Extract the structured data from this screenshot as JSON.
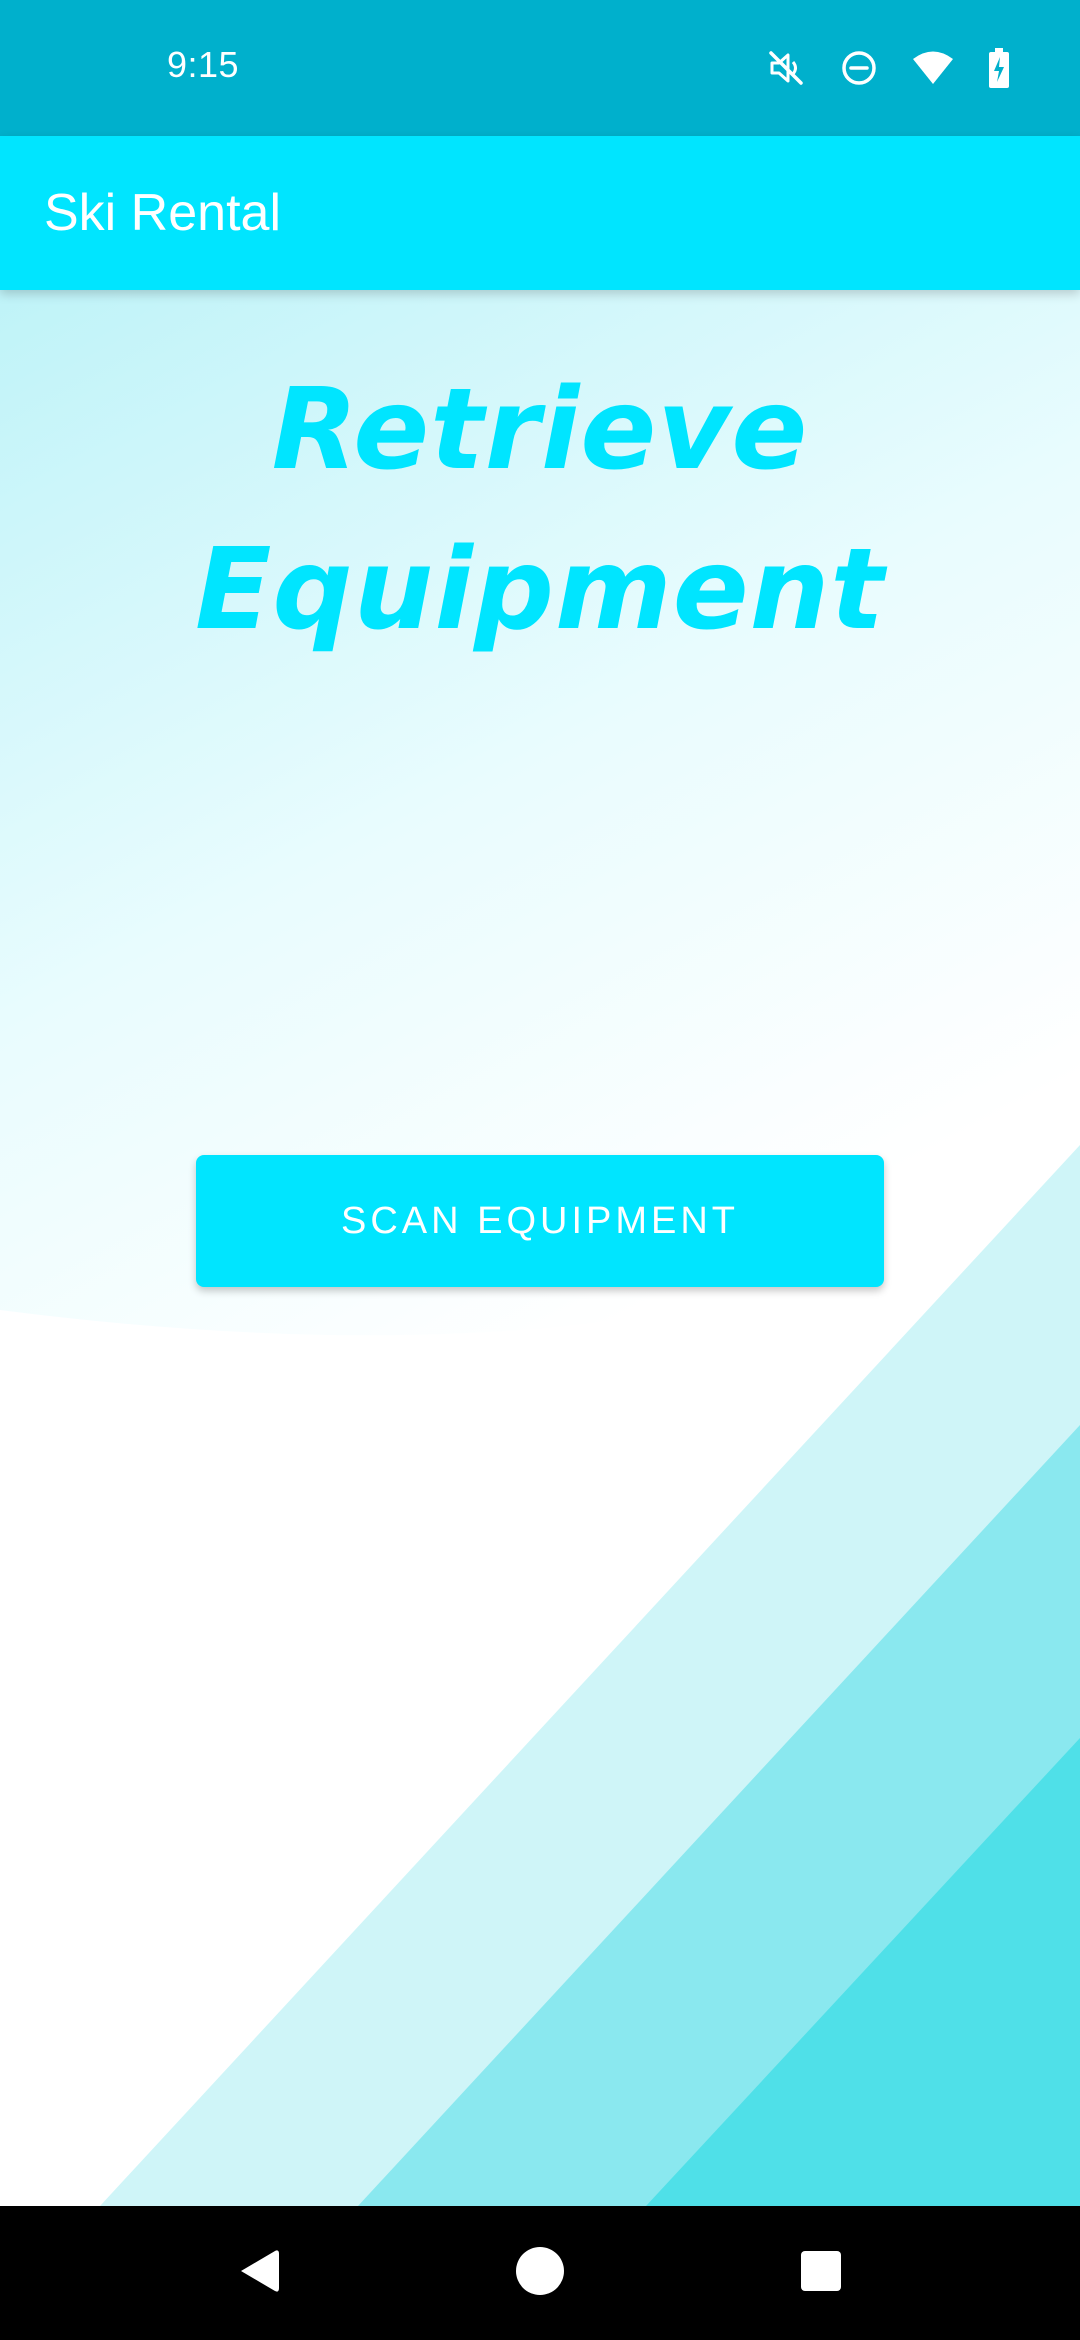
{
  "status_bar": {
    "time": "9:15",
    "icons": [
      "mute-icon",
      "do-not-disturb-icon",
      "wifi-icon",
      "battery-charging-icon"
    ]
  },
  "app_bar": {
    "title": "Ski Rental"
  },
  "main": {
    "heading_line1": "Retrieve",
    "heading_line2": "Equipment",
    "scan_button_label": "SCAN EQUIPMENT"
  },
  "nav_bar": {
    "buttons": [
      "back-icon",
      "home-icon",
      "recents-icon"
    ]
  },
  "colors": {
    "status_bar": "#00B0CC",
    "accent": "#00E5FF",
    "stripe_light": "#CFF5F8",
    "stripe_mid": "#8AE8EF",
    "stripe_dark": "#4FE0E8"
  }
}
